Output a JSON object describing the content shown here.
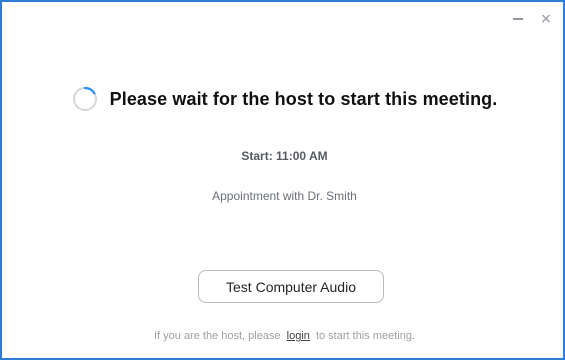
{
  "window": {
    "controls": {
      "minimize_icon": "minimize-icon",
      "close_icon": "close-icon",
      "close_glyph": "×"
    },
    "border_color": "#2d7fd3"
  },
  "main": {
    "spinner_icon": "loading-spinner-icon",
    "headline": "Please wait for the host to start this meeting.",
    "start_time": "Start: 11:00 AM",
    "meeting_topic": "Appointment with Dr. Smith",
    "test_audio_label": "Test Computer Audio"
  },
  "footer": {
    "host_note_prefix": "If you are the host, please",
    "login_link": "login",
    "host_note_suffix": "to start this meeting."
  }
}
